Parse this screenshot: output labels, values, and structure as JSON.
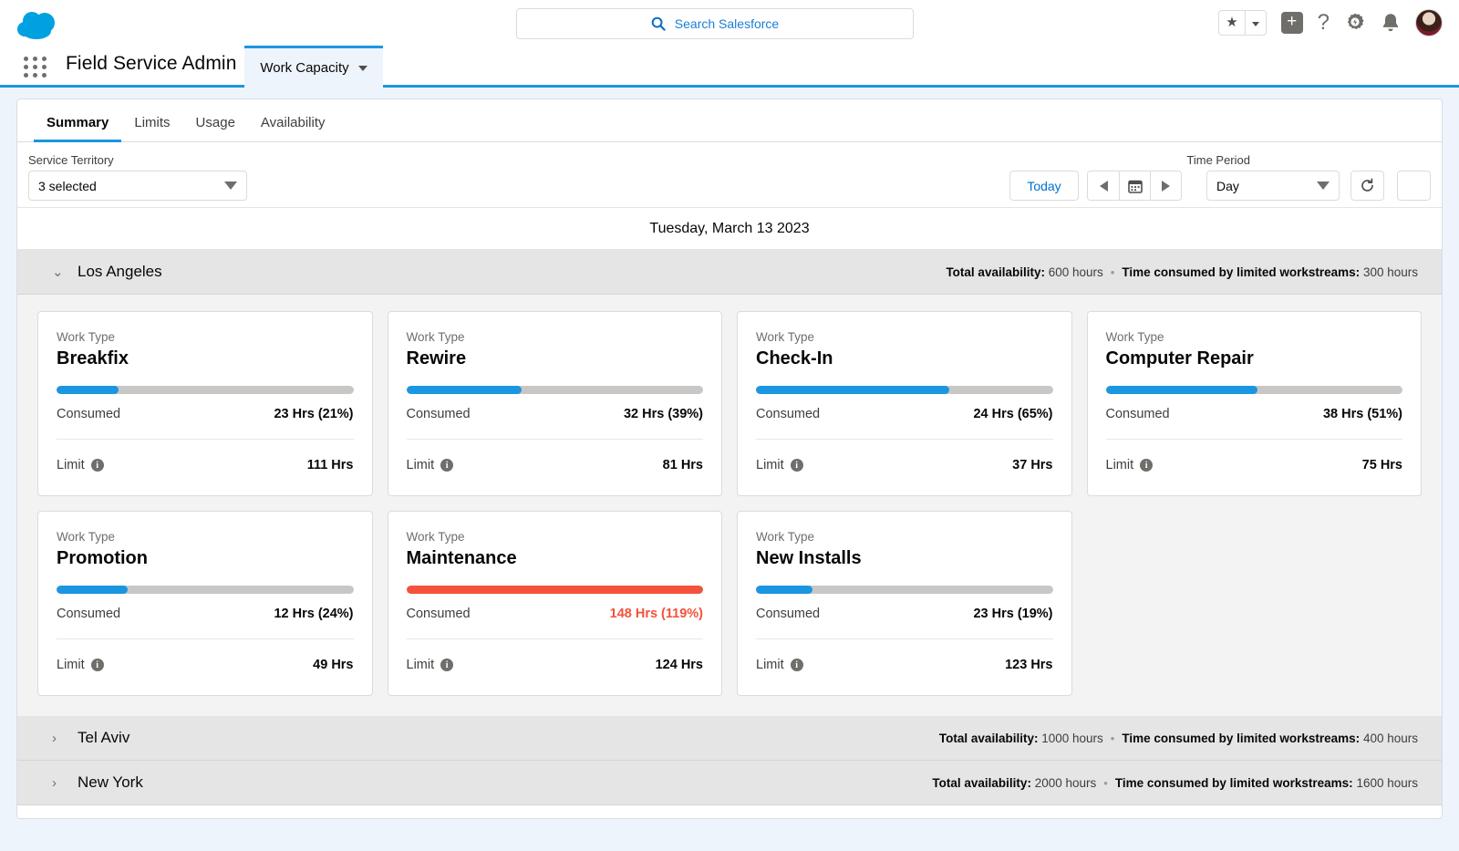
{
  "header": {
    "logo_icon": "salesforce-cloud-logo",
    "app_launcher_icon": "app-launcher-icon",
    "app_name": "Field Service Admin",
    "object_tab": "Work Capacity",
    "search_placeholder": "Search Salesforce",
    "search_icon": "search-icon",
    "icons": {
      "favorites": "star-icon",
      "favorites_caret": "chevron-down-icon",
      "new_item": "plus-square-icon",
      "help": "question-mark-icon",
      "setup": "gear-icon",
      "notifications": "bell-icon",
      "profile": "avatar"
    }
  },
  "tabs": [
    {
      "label": "Summary",
      "active": true
    },
    {
      "label": "Limits",
      "active": false
    },
    {
      "label": "Usage",
      "active": false
    },
    {
      "label": "Availability",
      "active": false
    }
  ],
  "filters": {
    "service_territory_label": "Service Territory",
    "service_territory_value": "3 selected",
    "today_label": "Today",
    "prev_icon": "chevron-left-icon",
    "calendar_icon": "calendar-icon",
    "next_icon": "chevron-right-icon",
    "time_period_label": "Time Period",
    "time_period_value": "Day",
    "refresh_icon": "refresh-icon",
    "more_icon": "chevron-down-icon"
  },
  "date_header": "Tuesday, March 13 2023",
  "stat_labels": {
    "total_availability": "Total availability:",
    "time_consumed": "Time consumed by limited workstreams:"
  },
  "territories": [
    {
      "name": "Los Angeles",
      "expanded": true,
      "chevron_icon": "chevron-down-icon",
      "total_availability": "600 hours",
      "time_consumed": "300 hours",
      "work_type_label": "Work Type",
      "consumed_label": "Consumed",
      "limit_label": "Limit",
      "cards": [
        {
          "name": "Breakfix",
          "consumed": "23 Hrs (21%)",
          "limit": "111 Hrs",
          "percent": 21,
          "over": false
        },
        {
          "name": "Rewire",
          "consumed": "32 Hrs (39%)",
          "limit": "81 Hrs",
          "percent": 39,
          "over": false
        },
        {
          "name": "Check-In",
          "consumed": "24 Hrs (65%)",
          "limit": "37 Hrs",
          "percent": 65,
          "over": false
        },
        {
          "name": "Computer Repair",
          "consumed": "38 Hrs (51%)",
          "limit": "75 Hrs",
          "percent": 51,
          "over": false
        },
        {
          "name": "Promotion",
          "consumed": "12 Hrs (24%)",
          "limit": "49 Hrs",
          "percent": 24,
          "over": false
        },
        {
          "name": "Maintenance",
          "consumed": "148 Hrs (119%)",
          "limit": "124 Hrs",
          "percent": 100,
          "over": true
        },
        {
          "name": "New Installs",
          "consumed": "23 Hrs (19%)",
          "limit": "123 Hrs",
          "percent": 19,
          "over": false
        }
      ]
    },
    {
      "name": "Tel Aviv",
      "expanded": false,
      "chevron_icon": "chevron-right-icon",
      "total_availability": "1000 hours",
      "time_consumed": "400 hours",
      "cards": []
    },
    {
      "name": "New York",
      "expanded": false,
      "chevron_icon": "chevron-right-icon",
      "total_availability": "2000 hours",
      "time_consumed": "1600 hours",
      "cards": []
    }
  ],
  "colors": {
    "brand_blue": "#1B96E0",
    "link_blue": "#0070D2",
    "over_limit_red": "#F4523B",
    "track_gray": "#C9C7C5"
  }
}
